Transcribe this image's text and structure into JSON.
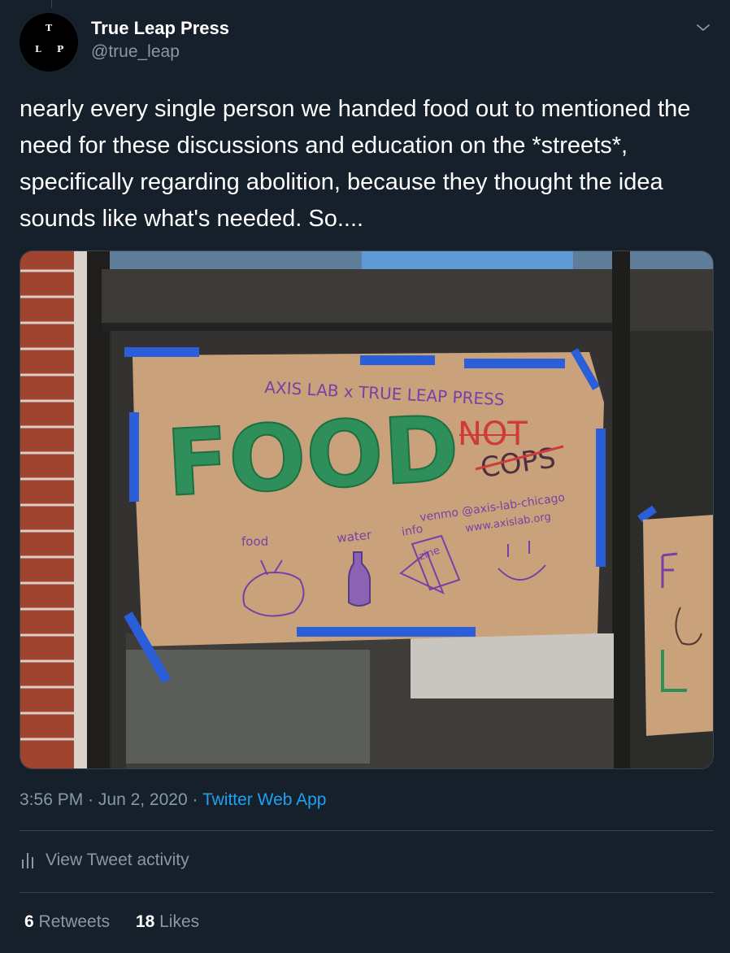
{
  "author": {
    "avatar_letters": [
      "T",
      "L",
      "P"
    ],
    "name": "True Leap Press",
    "handle": "@true_leap"
  },
  "tweet": {
    "text": "nearly every single person we handed food out to mentioned the need for these discussions and education on the *streets*, specifically regarding abolition, because they thought the idea sounds like what's needed. So....",
    "time": "3:56 PM",
    "date": "Jun 2, 2020",
    "source": "Twitter Web App"
  },
  "photo": {
    "sign_header": "AXIS LAB x TRUE LEAP PRESS",
    "sign_food": "FOOD",
    "sign_not": "NOT",
    "sign_cops": "COPS",
    "venmo": "venmo @axis-lab-chicago",
    "website": "www.axislab.org",
    "label_food": "food",
    "label_water": "water",
    "label_info": "info",
    "label_zine": "zine"
  },
  "activity": {
    "label": "View Tweet activity"
  },
  "stats": {
    "retweets_count": "6",
    "retweets_label": "Retweets",
    "likes_count": "18",
    "likes_label": "Likes"
  },
  "colors": {
    "background": "#15202b",
    "secondary_text": "#8899a6",
    "link": "#1da1f2",
    "divider": "#38444d"
  },
  "icons": {
    "menu": "chevron-down-icon",
    "activity": "bar-chart-icon"
  }
}
